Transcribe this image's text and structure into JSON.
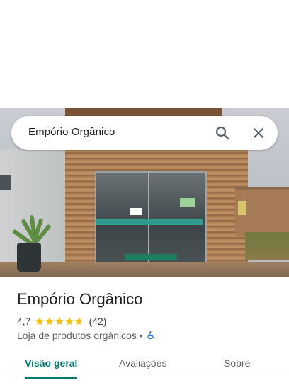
{
  "search": {
    "query": "Empório Orgânico"
  },
  "place": {
    "name": "Empório Orgânico",
    "rating": "4,7",
    "rating_stars": 4.7,
    "review_count": "(42)",
    "category": "Loja de produtos orgânicos",
    "separator": "•"
  },
  "tabs": [
    {
      "label": "Visão geral",
      "active": true
    },
    {
      "label": "Avaliações",
      "active": false
    },
    {
      "label": "Sobre",
      "active": false
    }
  ],
  "colors": {
    "accent": "#01796f",
    "star": "#fbbc04",
    "accessibility": "#1a73e8"
  },
  "icons": [
    "search-icon",
    "close-icon",
    "star-icon",
    "wheelchair-accessible-icon"
  ]
}
